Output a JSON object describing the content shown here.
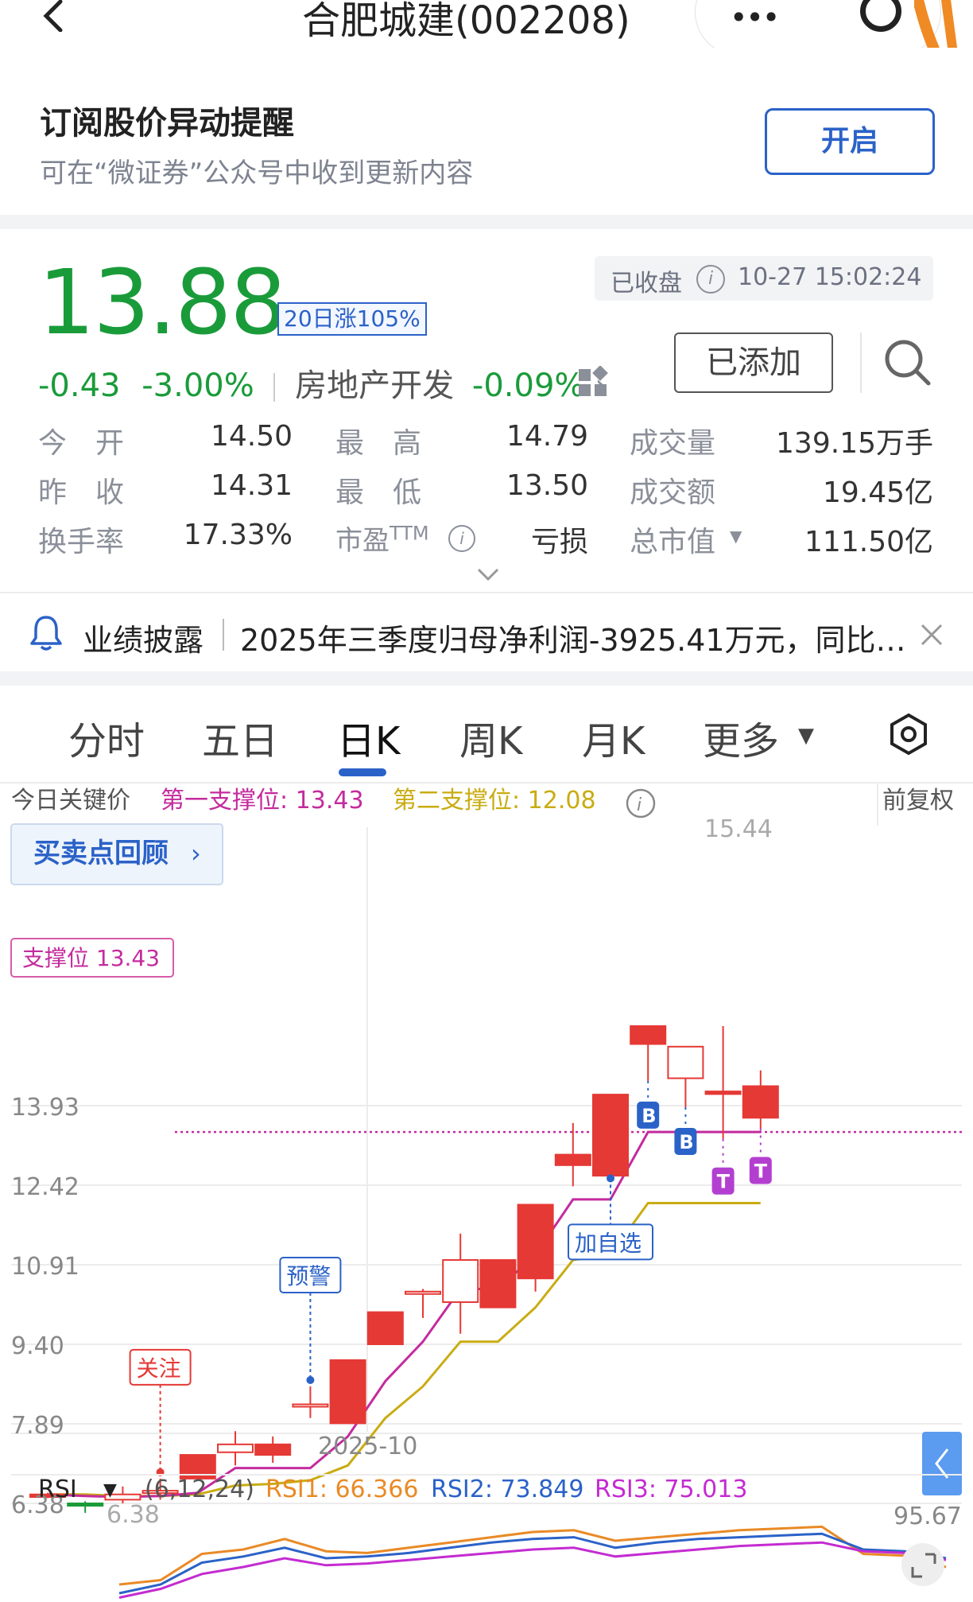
{
  "header": {
    "title": "合肥城建(002208)",
    "more_icon": "more-dots-icon",
    "target_icon": "target-icon",
    "back_icon": "back-arrow-icon"
  },
  "subscribe": {
    "title": "订阅股价异动提醒",
    "desc": "可在“微证券”公众号中收到更新内容",
    "button": "开启"
  },
  "quote": {
    "price": "13.88",
    "tag": "20日涨105%",
    "status": "已收盘",
    "time": "10-27 15:02:24",
    "change": "-0.43",
    "change_pct": "-3.00%",
    "sector": "房地产开发",
    "sector_pct": "-0.09%",
    "added_button": "已添加",
    "colors": {
      "down": "#1a9b3a",
      "up": "#e53935",
      "accent": "#2b62c8"
    }
  },
  "stats": [
    {
      "label": "今　开",
      "value": "14.50",
      "color": "red"
    },
    {
      "label": "最　高",
      "value": "14.79",
      "color": "red"
    },
    {
      "label": "成交量",
      "value": "139.15万手",
      "color": ""
    },
    {
      "label": "昨　收",
      "value": "14.31",
      "color": ""
    },
    {
      "label": "最　低",
      "value": "13.50",
      "color": "green"
    },
    {
      "label": "成交额",
      "value": "19.45亿",
      "color": ""
    },
    {
      "label": "换手率",
      "value": "17.33%",
      "color": ""
    },
    {
      "label": "市盈TTM",
      "value": "亏损",
      "color": ""
    },
    {
      "label": "总市值",
      "value": "111.50亿",
      "color": ""
    }
  ],
  "notice": {
    "label": "业绩披露",
    "text": "2025年三季度归母净利润-3925.41万元，同比…"
  },
  "tabs": [
    "分时",
    "五日",
    "日K",
    "周K",
    "月K",
    "更多"
  ],
  "chart_header": {
    "label": "今日关键价",
    "support1": "第一支撑位: 13.43",
    "support2": "第二支撑位: 12.08",
    "adjust": "前复权",
    "review_button": "买卖点回顾",
    "support_tag": "支撑位 13.43"
  },
  "chart_data": {
    "type": "candlestick",
    "y_ticks": [
      "13.93",
      "12.42",
      "10.91",
      "9.40",
      "7.89",
      "6.38"
    ],
    "y_values": [
      13.93,
      12.42,
      10.91,
      9.4,
      7.89,
      6.38
    ],
    "x_label": "2025-10",
    "max_label": "15.44",
    "min_label": "6.38",
    "support_line": 13.43,
    "candles": [
      {
        "o": 6.55,
        "c": 6.5,
        "h": 6.58,
        "l": 6.48
      },
      {
        "o": 6.38,
        "c": 6.38,
        "h": 6.42,
        "l": 6.2
      },
      {
        "o": 6.45,
        "c": 6.55,
        "h": 6.7,
        "l": 6.38
      },
      {
        "o": 6.6,
        "c": 6.62,
        "h": 6.85,
        "l": 6.45
      },
      {
        "o": 7.3,
        "c": 6.85,
        "h": 7.3,
        "l": 6.85
      },
      {
        "o": 7.35,
        "c": 7.5,
        "h": 7.75,
        "l": 7.1
      },
      {
        "o": 7.5,
        "c": 7.3,
        "h": 7.65,
        "l": 7.15
      },
      {
        "o": 8.26,
        "c": 8.26,
        "h": 8.6,
        "l": 8.0
      },
      {
        "o": 9.1,
        "c": 7.9,
        "h": 9.1,
        "l": 7.9
      },
      {
        "o": 10.01,
        "c": 9.4,
        "h": 10.01,
        "l": 9.4
      },
      {
        "o": 10.4,
        "c": 10.4,
        "h": 10.45,
        "l": 9.9
      },
      {
        "o": 10.2,
        "c": 11.0,
        "h": 11.5,
        "l": 9.6
      },
      {
        "o": 11.0,
        "c": 10.1,
        "h": 11.0,
        "l": 10.1
      },
      {
        "o": 12.05,
        "c": 10.65,
        "h": 12.05,
        "l": 10.4
      },
      {
        "o": 13.0,
        "c": 12.8,
        "h": 13.6,
        "l": 12.4
      },
      {
        "o": 14.14,
        "c": 12.6,
        "h": 14.14,
        "l": 12.55
      },
      {
        "o": 15.44,
        "c": 15.1,
        "h": 15.44,
        "l": 14.4
      },
      {
        "o": 14.45,
        "c": 15.05,
        "h": 15.05,
        "l": 13.9
      },
      {
        "o": 14.2,
        "c": 14.15,
        "h": 15.44,
        "l": 13.3
      },
      {
        "o": 14.3,
        "c": 13.7,
        "h": 14.6,
        "l": 13.5
      }
    ],
    "ma1": [
      6.55,
      6.52,
      6.5,
      6.52,
      6.58,
      7.05,
      7.05,
      7.05,
      7.65,
      8.7,
      9.45,
      10.45,
      10.45,
      11.1,
      12.15,
      12.15,
      13.43,
      13.43,
      13.43,
      13.43
    ],
    "ma2": [
      6.55,
      6.55,
      6.52,
      6.52,
      6.55,
      6.72,
      6.75,
      6.82,
      7.1,
      8.0,
      8.6,
      9.45,
      9.45,
      10.1,
      11.0,
      11.1,
      12.08,
      12.08,
      12.08,
      12.08
    ],
    "markers": [
      {
        "i": 3,
        "text": "关注",
        "color": "#e53935"
      },
      {
        "i": 7,
        "text": "预警",
        "color": "#2b62c8"
      },
      {
        "i": 15,
        "text": "加自选",
        "color": "#2b62c8"
      },
      {
        "i": 16,
        "text": "B",
        "color": "#2b62c8"
      },
      {
        "i": 17,
        "text": "B",
        "color": "#2b62c8"
      },
      {
        "i": 18,
        "text": "T",
        "color": "#b33fd1"
      },
      {
        "i": 19,
        "text": "T",
        "color": "#b33fd1"
      }
    ]
  },
  "rsi": {
    "label": "RSI",
    "params": "(6,12,24)",
    "rsi1": "RSI1: 66.366",
    "rsi2": "RSI2: 73.849",
    "rsi3": "RSI3: 75.013",
    "max": "95.67",
    "rsi1_color": "#e98a26",
    "rsi2_color": "#2b62c8",
    "rsi3_color": "#c42bd1",
    "series1": [
      20,
      25,
      55,
      60,
      72,
      58,
      56,
      62,
      68,
      74,
      80,
      82,
      70,
      74,
      78,
      82,
      84,
      86,
      55,
      53,
      40
    ],
    "series2": [
      10,
      20,
      45,
      52,
      62,
      50,
      52,
      56,
      62,
      68,
      72,
      74,
      62,
      68,
      72,
      74,
      76,
      78,
      60,
      58,
      50
    ],
    "series3": [
      5,
      15,
      32,
      40,
      50,
      42,
      44,
      48,
      52,
      56,
      60,
      62,
      52,
      56,
      60,
      64,
      66,
      68,
      58,
      56,
      48
    ]
  }
}
